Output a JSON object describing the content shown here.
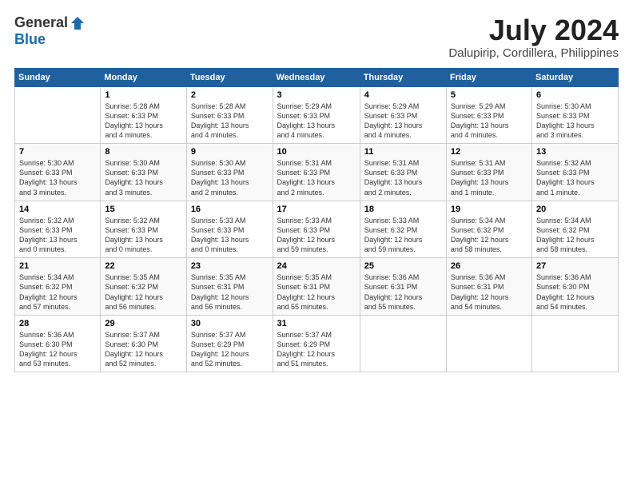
{
  "logo": {
    "line1": "General",
    "line2": "Blue"
  },
  "title": "July 2024",
  "location": "Dalupirip, Cordillera, Philippines",
  "days_of_week": [
    "Sunday",
    "Monday",
    "Tuesday",
    "Wednesday",
    "Thursday",
    "Friday",
    "Saturday"
  ],
  "weeks": [
    [
      {
        "day": "",
        "info": ""
      },
      {
        "day": "1",
        "info": "Sunrise: 5:28 AM\nSunset: 6:33 PM\nDaylight: 13 hours\nand 4 minutes."
      },
      {
        "day": "2",
        "info": "Sunrise: 5:28 AM\nSunset: 6:33 PM\nDaylight: 13 hours\nand 4 minutes."
      },
      {
        "day": "3",
        "info": "Sunrise: 5:29 AM\nSunset: 6:33 PM\nDaylight: 13 hours\nand 4 minutes."
      },
      {
        "day": "4",
        "info": "Sunrise: 5:29 AM\nSunset: 6:33 PM\nDaylight: 13 hours\nand 4 minutes."
      },
      {
        "day": "5",
        "info": "Sunrise: 5:29 AM\nSunset: 6:33 PM\nDaylight: 13 hours\nand 4 minutes."
      },
      {
        "day": "6",
        "info": "Sunrise: 5:30 AM\nSunset: 6:33 PM\nDaylight: 13 hours\nand 3 minutes."
      }
    ],
    [
      {
        "day": "7",
        "info": "Sunrise: 5:30 AM\nSunset: 6:33 PM\nDaylight: 13 hours\nand 3 minutes."
      },
      {
        "day": "8",
        "info": "Sunrise: 5:30 AM\nSunset: 6:33 PM\nDaylight: 13 hours\nand 3 minutes."
      },
      {
        "day": "9",
        "info": "Sunrise: 5:30 AM\nSunset: 6:33 PM\nDaylight: 13 hours\nand 2 minutes."
      },
      {
        "day": "10",
        "info": "Sunrise: 5:31 AM\nSunset: 6:33 PM\nDaylight: 13 hours\nand 2 minutes."
      },
      {
        "day": "11",
        "info": "Sunrise: 5:31 AM\nSunset: 6:33 PM\nDaylight: 13 hours\nand 2 minutes."
      },
      {
        "day": "12",
        "info": "Sunrise: 5:31 AM\nSunset: 6:33 PM\nDaylight: 13 hours\nand 1 minute."
      },
      {
        "day": "13",
        "info": "Sunrise: 5:32 AM\nSunset: 6:33 PM\nDaylight: 13 hours\nand 1 minute."
      }
    ],
    [
      {
        "day": "14",
        "info": "Sunrise: 5:32 AM\nSunset: 6:33 PM\nDaylight: 13 hours\nand 0 minutes."
      },
      {
        "day": "15",
        "info": "Sunrise: 5:32 AM\nSunset: 6:33 PM\nDaylight: 13 hours\nand 0 minutes."
      },
      {
        "day": "16",
        "info": "Sunrise: 5:33 AM\nSunset: 6:33 PM\nDaylight: 13 hours\nand 0 minutes."
      },
      {
        "day": "17",
        "info": "Sunrise: 5:33 AM\nSunset: 6:33 PM\nDaylight: 12 hours\nand 59 minutes."
      },
      {
        "day": "18",
        "info": "Sunrise: 5:33 AM\nSunset: 6:32 PM\nDaylight: 12 hours\nand 59 minutes."
      },
      {
        "day": "19",
        "info": "Sunrise: 5:34 AM\nSunset: 6:32 PM\nDaylight: 12 hours\nand 58 minutes."
      },
      {
        "day": "20",
        "info": "Sunrise: 5:34 AM\nSunset: 6:32 PM\nDaylight: 12 hours\nand 58 minutes."
      }
    ],
    [
      {
        "day": "21",
        "info": "Sunrise: 5:34 AM\nSunset: 6:32 PM\nDaylight: 12 hours\nand 57 minutes."
      },
      {
        "day": "22",
        "info": "Sunrise: 5:35 AM\nSunset: 6:32 PM\nDaylight: 12 hours\nand 56 minutes."
      },
      {
        "day": "23",
        "info": "Sunrise: 5:35 AM\nSunset: 6:31 PM\nDaylight: 12 hours\nand 56 minutes."
      },
      {
        "day": "24",
        "info": "Sunrise: 5:35 AM\nSunset: 6:31 PM\nDaylight: 12 hours\nand 55 minutes."
      },
      {
        "day": "25",
        "info": "Sunrise: 5:36 AM\nSunset: 6:31 PM\nDaylight: 12 hours\nand 55 minutes."
      },
      {
        "day": "26",
        "info": "Sunrise: 5:36 AM\nSunset: 6:31 PM\nDaylight: 12 hours\nand 54 minutes."
      },
      {
        "day": "27",
        "info": "Sunrise: 5:36 AM\nSunset: 6:30 PM\nDaylight: 12 hours\nand 54 minutes."
      }
    ],
    [
      {
        "day": "28",
        "info": "Sunrise: 5:36 AM\nSunset: 6:30 PM\nDaylight: 12 hours\nand 53 minutes."
      },
      {
        "day": "29",
        "info": "Sunrise: 5:37 AM\nSunset: 6:30 PM\nDaylight: 12 hours\nand 52 minutes."
      },
      {
        "day": "30",
        "info": "Sunrise: 5:37 AM\nSunset: 6:29 PM\nDaylight: 12 hours\nand 52 minutes."
      },
      {
        "day": "31",
        "info": "Sunrise: 5:37 AM\nSunset: 6:29 PM\nDaylight: 12 hours\nand 51 minutes."
      },
      {
        "day": "",
        "info": ""
      },
      {
        "day": "",
        "info": ""
      },
      {
        "day": "",
        "info": ""
      }
    ]
  ]
}
